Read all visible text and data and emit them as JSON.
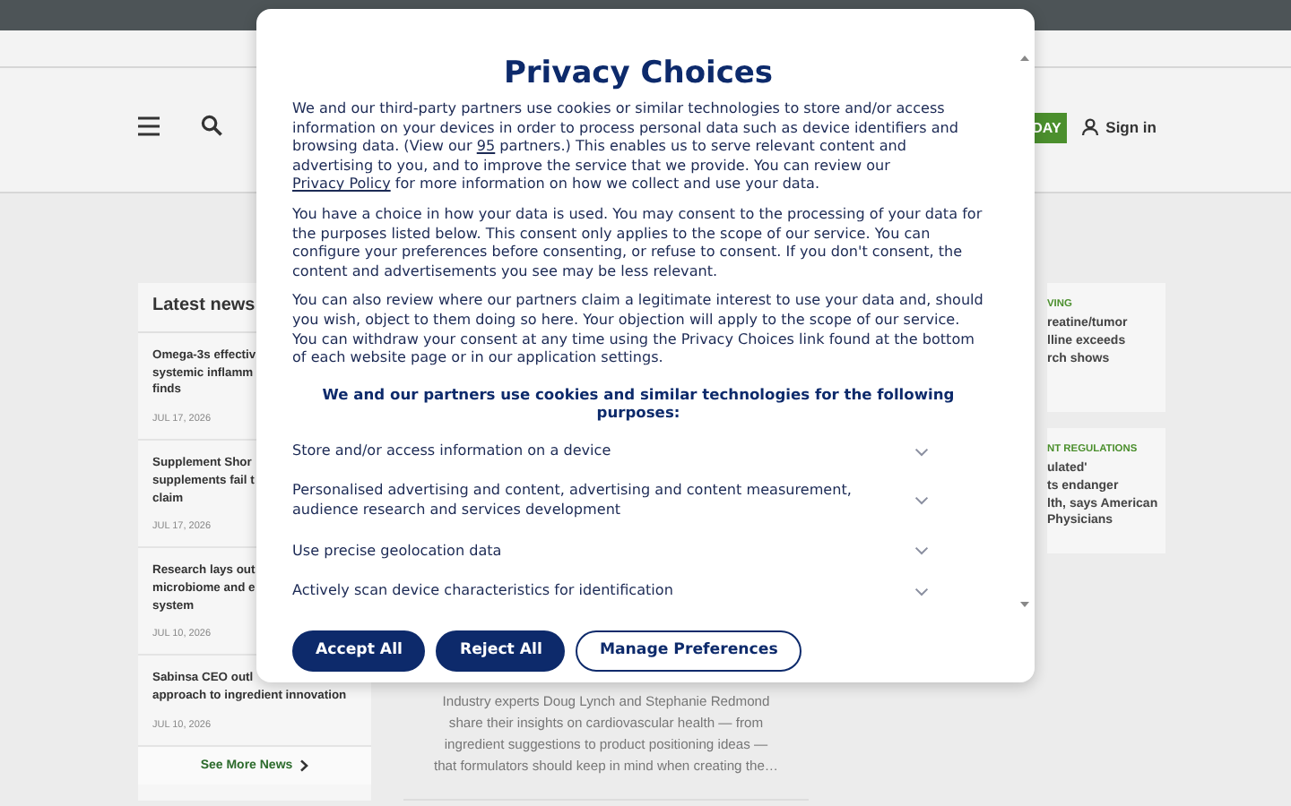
{
  "header": {
    "subscribe_button": "DAY",
    "sign_in": "Sign in"
  },
  "latest_news": {
    "title": "Latest news",
    "items": [
      {
        "lines": [
          "Omega-3s effectiv",
          "systemic inflamm",
          "finds"
        ],
        "date": "JUL 17, 2026"
      },
      {
        "lines": [
          "Supplement Shor",
          "supplements fail t",
          "claim"
        ],
        "date": "JUL 17, 2026"
      },
      {
        "lines": [
          "Research lays out",
          "microbiome and e",
          "system"
        ],
        "date": "JUL 10, 2026"
      },
      {
        "lines": [
          "Sabinsa CEO outl",
          "approach to ingredient innovation"
        ],
        "date": "JUL 10, 2026"
      }
    ],
    "more_link": "See More News"
  },
  "featured_excerpt": [
    "Industry experts Doug Lynch and Stephanie Redmond",
    "share their insights on cardiovascular health — from",
    "ingredient suggestions to product positioning ideas —",
    "that formulators should keep in mind when creating the…"
  ],
  "side_cards": [
    {
      "category": "VING",
      "lines": [
        "reatine/tumor",
        "lline exceeds",
        "rch shows"
      ]
    },
    {
      "category": "NT REGULATIONS",
      "lines": [
        "ulated'",
        "ts endanger",
        "lth, says American",
        "Physicians"
      ]
    }
  ],
  "modal": {
    "title": "Privacy Choices",
    "paragraphs": [
      [
        {
          "text": "We and our third-party partners use cookies or similar technologies to store and/or access information on your devices in order to process personal data such as device identifiers and browsing data. (View our "
        },
        {
          "text": "95",
          "kind": "link"
        },
        {
          "text": " partners.) This enables us to serve relevant content and advertising to you, and to improve the service that we provide. You can review our "
        },
        {
          "text": "Privacy Policy",
          "kind": "link"
        },
        {
          "text": " for more information on how we collect and use your data."
        }
      ],
      [
        {
          "text": "You have a choice in how your data is used. You may consent to the processing of your data for the purposes listed below. This consent only applies to the scope of our service. You can configure your preferences before consenting, or refuse to consent. If you don't consent, the content and advertisements you see may be less relevant."
        }
      ],
      [
        {
          "text": "You can also review where our partners claim a legitimate interest to use your data and, should you wish, object to them doing so here. Your objection will apply to the scope of our service. You can withdraw your consent at any time using the Privacy Choices link found at the bottom of each website page or in our application settings."
        }
      ]
    ],
    "purposes_heading": "We and our partners use cookies and similar technologies for the following purposes:",
    "purposes": [
      {
        "label": "Store and/or access information on a device",
        "expanded": false
      },
      {
        "label": "Personalised advertising and content, advertising and content measurement, audience research and services development",
        "expanded": false
      },
      {
        "label": "Use precise geolocation data",
        "expanded": false
      },
      {
        "label": "Actively scan device characteristics for identification",
        "expanded": false
      }
    ],
    "buttons": [
      {
        "label": "Accept All",
        "kind": "primary"
      },
      {
        "label": "Reject All",
        "kind": "primary"
      },
      {
        "label": "Manage Preferences",
        "kind": "outline"
      }
    ]
  }
}
